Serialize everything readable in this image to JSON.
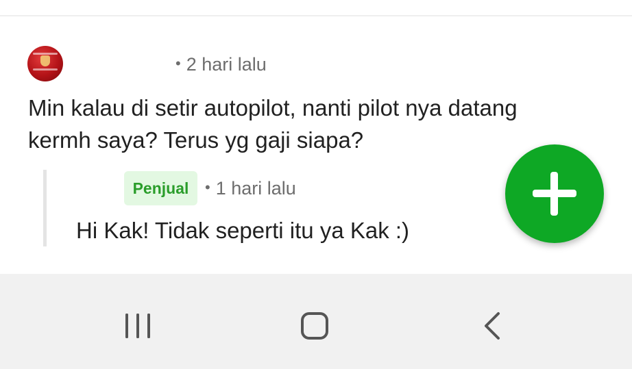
{
  "comment": {
    "time": "2 hari lalu",
    "text": "Min kalau di setir autopilot, nanti pilot nya datang kermh saya? Terus yg gaji siapa?"
  },
  "reply": {
    "badge": "Penjual",
    "time": "1 hari lalu",
    "text": "Hi Kak! Tidak seperti itu ya Kak :)"
  },
  "meta_separator": "•",
  "fab": {
    "icon": "plus-icon",
    "color": "#0ea825"
  },
  "navbar": {
    "recents_icon": "recents-icon",
    "home_icon": "home-icon",
    "back_icon": "back-icon"
  },
  "colors": {
    "seller_badge_bg": "#e3f8e2",
    "seller_badge_text": "#2a9d2a"
  }
}
